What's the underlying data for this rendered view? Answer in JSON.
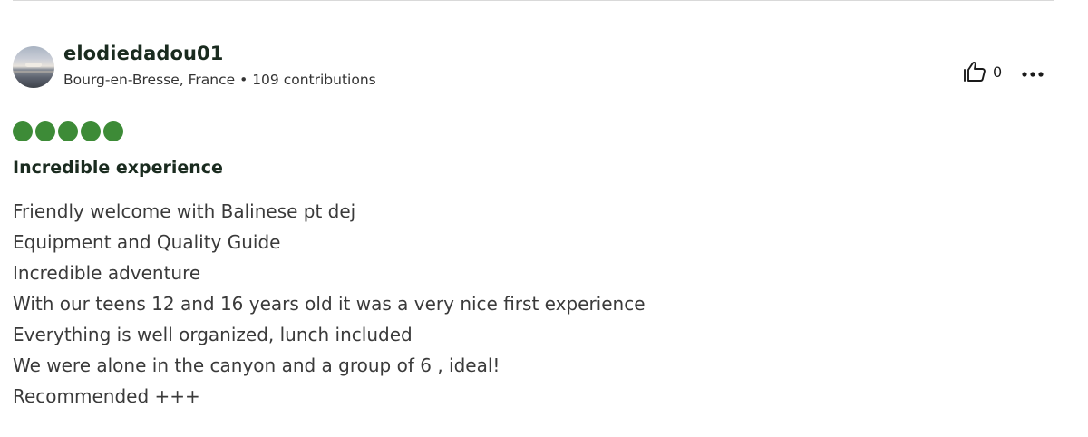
{
  "reviewer": {
    "name": "elodiedadou01",
    "location": "Bourg-en-Bresse, France",
    "separator": "•",
    "contributions": "109 contributions"
  },
  "actions": {
    "helpful_count": "0",
    "helpful_icon": "thumbs-up-icon",
    "more_icon": "more-horizontal-icon"
  },
  "review": {
    "rating": 5,
    "rating_color": "#3d8b37",
    "title": "Incredible experience",
    "body_lines": [
      "Friendly welcome with Balinese pt dej",
      "Equipment and Quality Guide",
      "Incredible adventure",
      "With our teens 12 and 16 years old it was a very nice first experience",
      "Everything is well organized, lunch included",
      "We were alone in the canyon and a group of 6 , ideal!",
      "Recommended +++"
    ]
  }
}
